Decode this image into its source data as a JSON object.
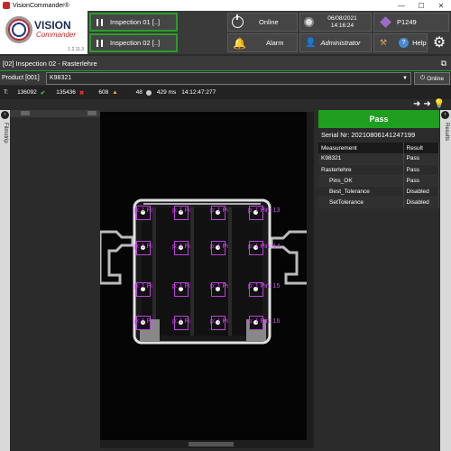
{
  "window": {
    "title": "VisionCommander®"
  },
  "logo": {
    "line1": "VISION",
    "line2": "Commander",
    "version": "1.2.11.3"
  },
  "header": {
    "inspection1": "Inspection 01 [..]",
    "inspection2": "Inspection 02 [..]",
    "online_label": "Online",
    "alarm_label": "Alarm",
    "date": "06/08/2021",
    "time": "14:16:24",
    "user": "Administrator",
    "station": "P1249",
    "help_label": "Help"
  },
  "inspection_bar": {
    "title": "[02] Inspection 02 - Rasterlehre"
  },
  "product": {
    "label": "Product [001]",
    "value": "K98321",
    "online_button": "Online"
  },
  "stats": {
    "prefix": "T:",
    "total": "136092",
    "pass": "135436",
    "warn": "608",
    "count": "48",
    "time_ms": "429 ms",
    "timestamp": "14:12:47:277"
  },
  "left_panel": {
    "label": "Filmstrip"
  },
  "right_panel": {
    "label": "Results"
  },
  "results": {
    "status": "Pass",
    "serial": "Serial Nr: 20210806141247199",
    "columns": [
      "Measurement",
      "Result"
    ],
    "rows": [
      {
        "name": "K98321",
        "result": "Pass"
      },
      {
        "name": "Rasterlehre",
        "result": "Pass"
      },
      {
        "name": "Pins_OK",
        "result": "Pass"
      },
      {
        "name": "Best_Tolerance",
        "result": "Disabled"
      },
      {
        "name": "SetTolerance",
        "result": "Disabled"
      }
    ]
  },
  "overlay_labels": {
    "row1": "p: 1 Pin: 13",
    "row2": "p: 1 Pin: 14",
    "row3": "p: 1 Pin: 15",
    "row4": "p: 1 Pin: 16",
    "fragment": "p: 1 Pi"
  },
  "colors": {
    "pass_green": "#1f9e1f",
    "accent_green": "#2a9d2a",
    "overlay_magenta": "#c040e0"
  }
}
